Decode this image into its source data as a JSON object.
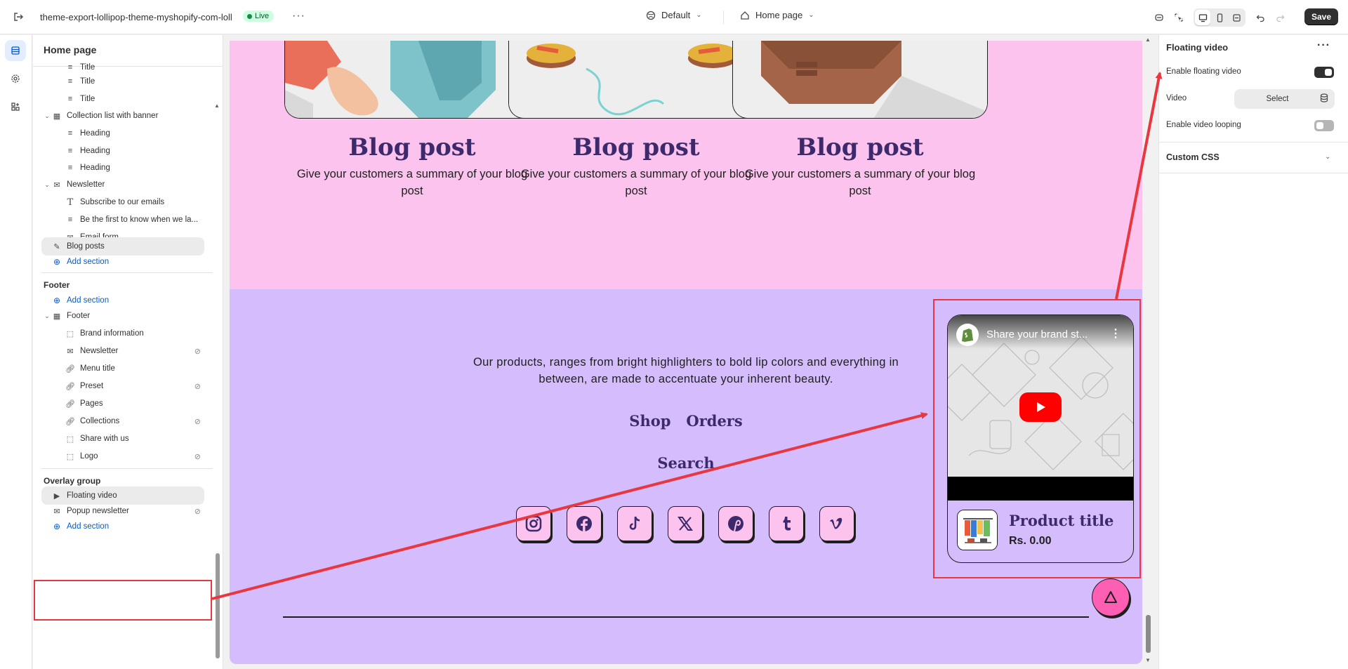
{
  "topbar": {
    "store_name": "theme-export-lollipop-theme-myshopify-com-loll",
    "status_badge": "Live",
    "theme_selector": "Default",
    "page_selector": "Home page",
    "save_label": "Save"
  },
  "sidebar": {
    "title": "Home page",
    "template_items": [
      {
        "label": "Title",
        "icon": "text-lines-icon",
        "level": 2
      },
      {
        "label": "Title",
        "icon": "text-lines-icon",
        "level": 2
      },
      {
        "label": "Title",
        "icon": "text-lines-icon",
        "level": 2
      },
      {
        "label": "Collection list with banner",
        "icon": "collection-list-icon",
        "level": 1
      },
      {
        "label": "Heading",
        "icon": "text-lines-icon",
        "level": 2
      },
      {
        "label": "Heading",
        "icon": "text-lines-icon",
        "level": 2
      },
      {
        "label": "Heading",
        "icon": "text-lines-icon",
        "level": 2
      },
      {
        "label": "Newsletter",
        "icon": "envelope-icon",
        "level": 1
      },
      {
        "label": "Subscribe to our emails",
        "icon": "text-type-icon",
        "level": 2
      },
      {
        "label": "Be the first to know when we la...",
        "icon": "text-lines-icon",
        "level": 2
      },
      {
        "label": "Email form",
        "icon": "envelope-icon",
        "level": 2
      },
      {
        "label": "Blog posts",
        "icon": "blog-icon",
        "level": 1
      }
    ],
    "add_section_label": "Add section",
    "footer_group_label": "Footer",
    "footer_items": [
      {
        "label": "Footer",
        "icon": "footer-icon",
        "level": 1
      },
      {
        "label": "Brand information",
        "icon": "block-icon",
        "level": 2
      },
      {
        "label": "Newsletter",
        "icon": "envelope-icon",
        "level": 2,
        "hidden": true
      },
      {
        "label": "Menu title",
        "icon": "link-icon",
        "level": 2
      },
      {
        "label": "Preset",
        "icon": "link-icon",
        "level": 2,
        "hidden": true
      },
      {
        "label": "Pages",
        "icon": "link-icon",
        "level": 2
      },
      {
        "label": "Collections",
        "icon": "link-icon",
        "level": 2,
        "hidden": true
      },
      {
        "label": "Share with us",
        "icon": "block-icon",
        "level": 2
      },
      {
        "label": "Logo",
        "icon": "block-icon",
        "level": 2,
        "hidden": true
      }
    ],
    "overlay_group_label": "Overlay group",
    "overlay_items": [
      {
        "label": "Floating video",
        "icon": "play-circle-icon"
      },
      {
        "label": "Popup newsletter",
        "icon": "envelope-icon",
        "hidden": true
      }
    ]
  },
  "preview": {
    "blog_posts": [
      {
        "title": "Blog post",
        "summary": "Give your customers a summary of your blog post"
      },
      {
        "title": "Blog post",
        "summary": "Give your customers a summary of your blog post"
      },
      {
        "title": "Blog post",
        "summary": "Give your customers a summary of your blog post"
      }
    ],
    "footer_text": "Our products, ranges from bright highlighters to bold lip colors and everything in between, are made to accentuate your inherent beauty.",
    "footer_links": [
      "Shop",
      "Orders"
    ],
    "footer_search": "Search",
    "socials": [
      "instagram-icon",
      "facebook-icon",
      "tiktok-icon",
      "x-icon",
      "pinterest-icon",
      "tumblr-icon",
      "vimeo-icon"
    ],
    "floating_video": {
      "video_title": "Share your brand st...",
      "product_title": "Product title",
      "price": "Rs. 0.00"
    }
  },
  "settings": {
    "title": "Floating video",
    "enable_floating_label": "Enable floating video",
    "enable_floating_value": true,
    "video_label": "Video",
    "video_select_label": "Select",
    "looping_label": "Enable video looping",
    "looping_value": false,
    "custom_css_label": "Custom CSS"
  },
  "colors": {
    "blog_bg": "#fbc3ed",
    "footer_bg": "#d5bcfd",
    "heading": "#3d2a6c",
    "annotation": "#e8373f",
    "link_blue": "#005bd3"
  }
}
